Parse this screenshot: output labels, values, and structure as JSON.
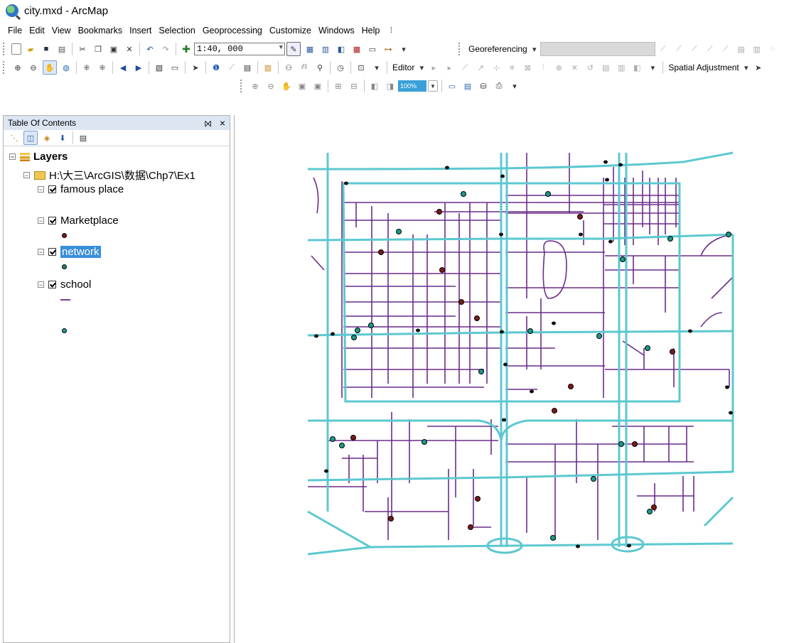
{
  "window": {
    "title": "city.mxd - ArcMap"
  },
  "menu": [
    "File",
    "Edit",
    "View",
    "Bookmarks",
    "Insert",
    "Selection",
    "Geoprocessing",
    "Customize",
    "Windows",
    "Help"
  ],
  "toolbar": {
    "scale_value": "1:40, 000",
    "georeferencing_label": "Georeferencing",
    "editor_label": "Editor",
    "spatial_adjustment_label": "Spatial Adjustment",
    "zoom_percent": "100%"
  },
  "toc": {
    "title": "Table Of Contents",
    "pin": "⨝",
    "close": "×",
    "root": "Layers",
    "folder": "H:\\大三\\ArcGIS\\数据\\Chp7\\Ex1",
    "layers": [
      {
        "name": "famous place",
        "checked": true,
        "symbol": "point",
        "color": "#7a1a1a"
      },
      {
        "name": "Marketplace",
        "checked": true,
        "symbol": "point",
        "color": "#1f8a6a"
      },
      {
        "name": "network",
        "checked": true,
        "symbol": "line",
        "color": "#7a3a9a",
        "selected": true
      },
      {
        "name": "school",
        "checked": true,
        "symbol": "point",
        "color": "#1f8a8a"
      }
    ]
  },
  "map": {
    "colors": {
      "main_road": "#5cc8d0",
      "street": "#6a2c8a",
      "famous_place": "#7a1a1a",
      "marketplace": "#1f8a6a",
      "school": "#1aa0a0"
    }
  }
}
